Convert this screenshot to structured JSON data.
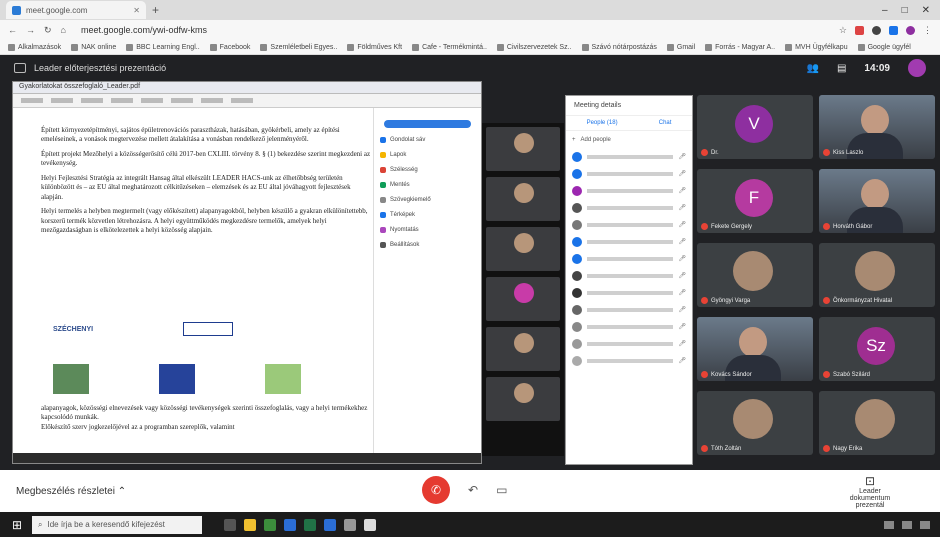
{
  "browser": {
    "tab_title": "meet.google.com",
    "url": "meet.google.com/ywi-odfw-kms",
    "bookmarks": [
      "Alkalmazások",
      "NAK online",
      "BBC Learning Engl..",
      "Facebook",
      "Szemléletbeli Egyes..",
      "Földműves Kft",
      "Cafe - Termékmintá..",
      "Civilszervezetek Sz..",
      "Szávó nótárpostázás",
      "Gmail",
      "Forrás - Magyar A..",
      "MVH Ügyfélkapu",
      "Google ügyfél"
    ],
    "window_controls": [
      "–",
      "□",
      "✕"
    ]
  },
  "meet": {
    "header_title": "Leader előterjesztési prezentáció",
    "time": "14:09",
    "details_label": "Megbeszélés részletei",
    "present_label": "Leader dokumentum prezentál"
  },
  "shared_screen": {
    "window_title": "Gyakorlatokat összefoglaló_Leader.pdf",
    "paragraphs": [
      "Épített környezetépítményi, sajátos épületrenovációs parasztházak, hatásában, gyökérbeli, amely az építési emeléseinek, a vonások megtervezése mellett átalakítása a vonásban rendelkező jelenményéről.",
      "Épített projekt Mezőhelyi a közösségerősítő célú 2017-ben CXLIII. törvény 8. § (1) bekezdése szerint megkezdeni az tevékenység.",
      "Helyi Fejlesztési Stratégia az integrált Hansag által elkészült LEADER HACS-unk az élhetőbbség területén különbözött és – az EU által meghatározott célkitűzéseken – elemzések és az EU által jóváhagyott fejlesztések alapján.",
      "Helyi termelés a helyben megtermelt (vagy előkészített) alapanyagokból, helyben készülő a gyakran elkülönítettebb, korszerű termék közvetlen létrehozásra. A helyi együttműködés megkezdésre termelők, amelyek helyi mezőgazdaságban is elkötelezettek a helyi közösség alapjain."
    ],
    "footer_text": "alapanyagok, közösségi elnevezések vagy közösségi tevékenységek szerinti összefoglalás, vagy a helyi termékekhez kapcsolódó munkák.",
    "footer_text2": "Előkészítő szerv jogkezelőjével az a programban szereplők, valamint",
    "logo_text": "SZÉCHENYI",
    "panel_items": [
      "Gondolat sáv",
      "Lapok",
      "Szélesség",
      "Mentés",
      "Szövegkiemelő",
      "Térképek",
      "Nyomtatás",
      "Beállítások"
    ]
  },
  "meeting_details": {
    "title": "Meeting details",
    "tab_people": "People (18)",
    "tab_chat": "Chat",
    "add_people": "Add people"
  },
  "participants": [
    {
      "name": "Dr.",
      "initial": "V",
      "color": "#8e2fa0"
    },
    {
      "name": "Kiss Laszlo",
      "initial": "",
      "color": ""
    },
    {
      "name": "Fekete Gergely",
      "initial": "F",
      "color": "#b53aa0"
    },
    {
      "name": "Horváth Gábor",
      "initial": "",
      "color": ""
    },
    {
      "name": "Gyöngyi Varga",
      "initial": "",
      "color": ""
    },
    {
      "name": "Önkormányzat Hivatal",
      "initial": "",
      "color": ""
    },
    {
      "name": "Kovács Sándor",
      "initial": "",
      "color": ""
    },
    {
      "name": "Szabó Szilárd",
      "initial": "Sz",
      "color": "#9f2e91"
    },
    {
      "name": "Tóth Zoltán",
      "initial": "",
      "color": ""
    },
    {
      "name": "Nagy Erika",
      "initial": "",
      "color": ""
    }
  ],
  "windows": {
    "search_placeholder": "Ide írja be a keresendő kifejezést"
  }
}
